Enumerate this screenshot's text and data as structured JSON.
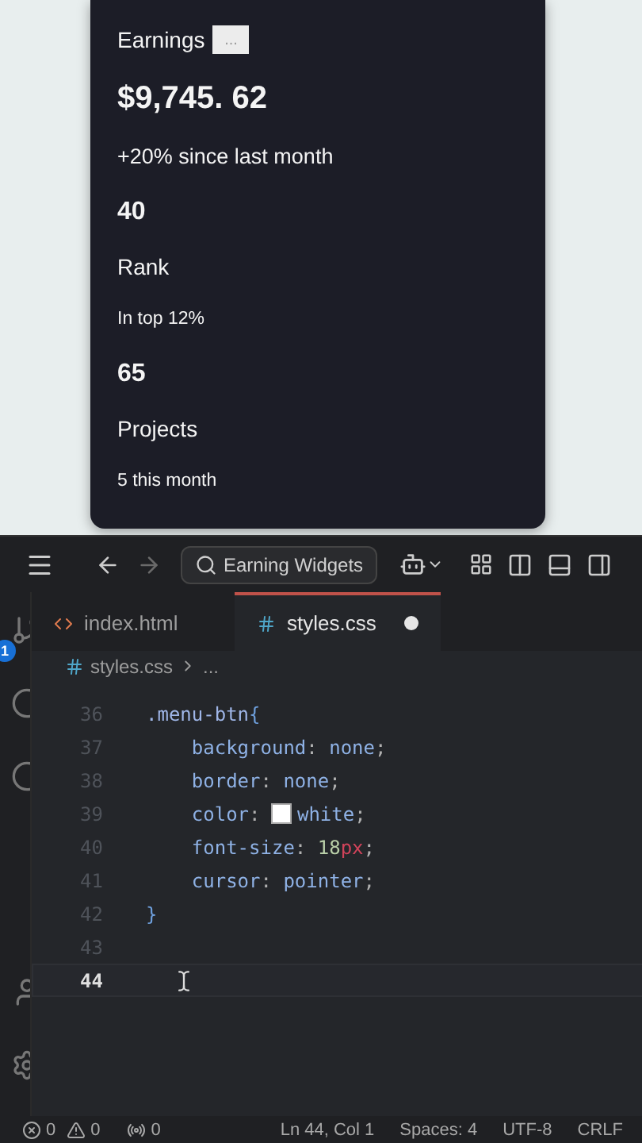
{
  "preview": {
    "card": {
      "title": "Earnings",
      "title_button": "...",
      "amount": "$9,745. 62",
      "change": "+20% since last month",
      "stats": [
        {
          "value": "40",
          "label": "Rank",
          "note": "In top 12%"
        },
        {
          "value": "65",
          "label": "Projects",
          "note": "5 this month"
        }
      ]
    }
  },
  "titlebar": {
    "search": "Earning Widgets"
  },
  "activity_bar": {
    "badge": "1"
  },
  "tabs": [
    {
      "label": "index.html",
      "kind": "html",
      "selected": false,
      "modified": false
    },
    {
      "label": "styles.css",
      "kind": "css",
      "selected": true,
      "modified": true
    }
  ],
  "breadcrumb": {
    "file": "styles.css",
    "rest": "..."
  },
  "editor": {
    "lines": [
      {
        "number": "36",
        "current": false,
        "tokens": [
          {
            "kind": "selector",
            "text": ".menu-btn"
          },
          {
            "kind": "brace",
            "text": "{"
          }
        ]
      },
      {
        "number": "37",
        "current": false,
        "tokens": [
          {
            "kind": "property",
            "text": "    background"
          },
          {
            "kind": "punct",
            "text": ": "
          },
          {
            "kind": "value",
            "text": "none"
          },
          {
            "kind": "punct",
            "text": ";"
          }
        ]
      },
      {
        "number": "38",
        "current": false,
        "tokens": [
          {
            "kind": "property",
            "text": "    border"
          },
          {
            "kind": "punct",
            "text": ": "
          },
          {
            "kind": "value",
            "text": "none"
          },
          {
            "kind": "punct",
            "text": ";"
          }
        ]
      },
      {
        "number": "39",
        "current": false,
        "tokens": [
          {
            "kind": "property",
            "text": "    color"
          },
          {
            "kind": "punct",
            "text": ": "
          },
          {
            "kind": "swatch",
            "color": "#ffffff"
          },
          {
            "kind": "value",
            "text": "white"
          },
          {
            "kind": "punct",
            "text": ";"
          }
        ]
      },
      {
        "number": "40",
        "current": false,
        "tokens": [
          {
            "kind": "property",
            "text": "    font-size"
          },
          {
            "kind": "punct",
            "text": ": "
          },
          {
            "kind": "number",
            "text": "18"
          },
          {
            "kind": "unit",
            "text": "px"
          },
          {
            "kind": "punct",
            "text": ";"
          }
        ]
      },
      {
        "number": "41",
        "current": false,
        "tokens": [
          {
            "kind": "property",
            "text": "    cursor"
          },
          {
            "kind": "punct",
            "text": ": "
          },
          {
            "kind": "value",
            "text": "pointer"
          },
          {
            "kind": "punct",
            "text": ";"
          }
        ]
      },
      {
        "number": "42",
        "current": false,
        "tokens": [
          {
            "kind": "brace",
            "text": "}"
          }
        ]
      },
      {
        "number": "43",
        "current": false
      },
      {
        "number": "44",
        "current": true
      }
    ]
  },
  "status_bar": {
    "errors": "0",
    "warnings": "0",
    "ports": "0",
    "position": "Ln 44, Col 1",
    "indent": "Spaces: 4",
    "encoding": "UTF-8",
    "eol": "CRLF"
  }
}
